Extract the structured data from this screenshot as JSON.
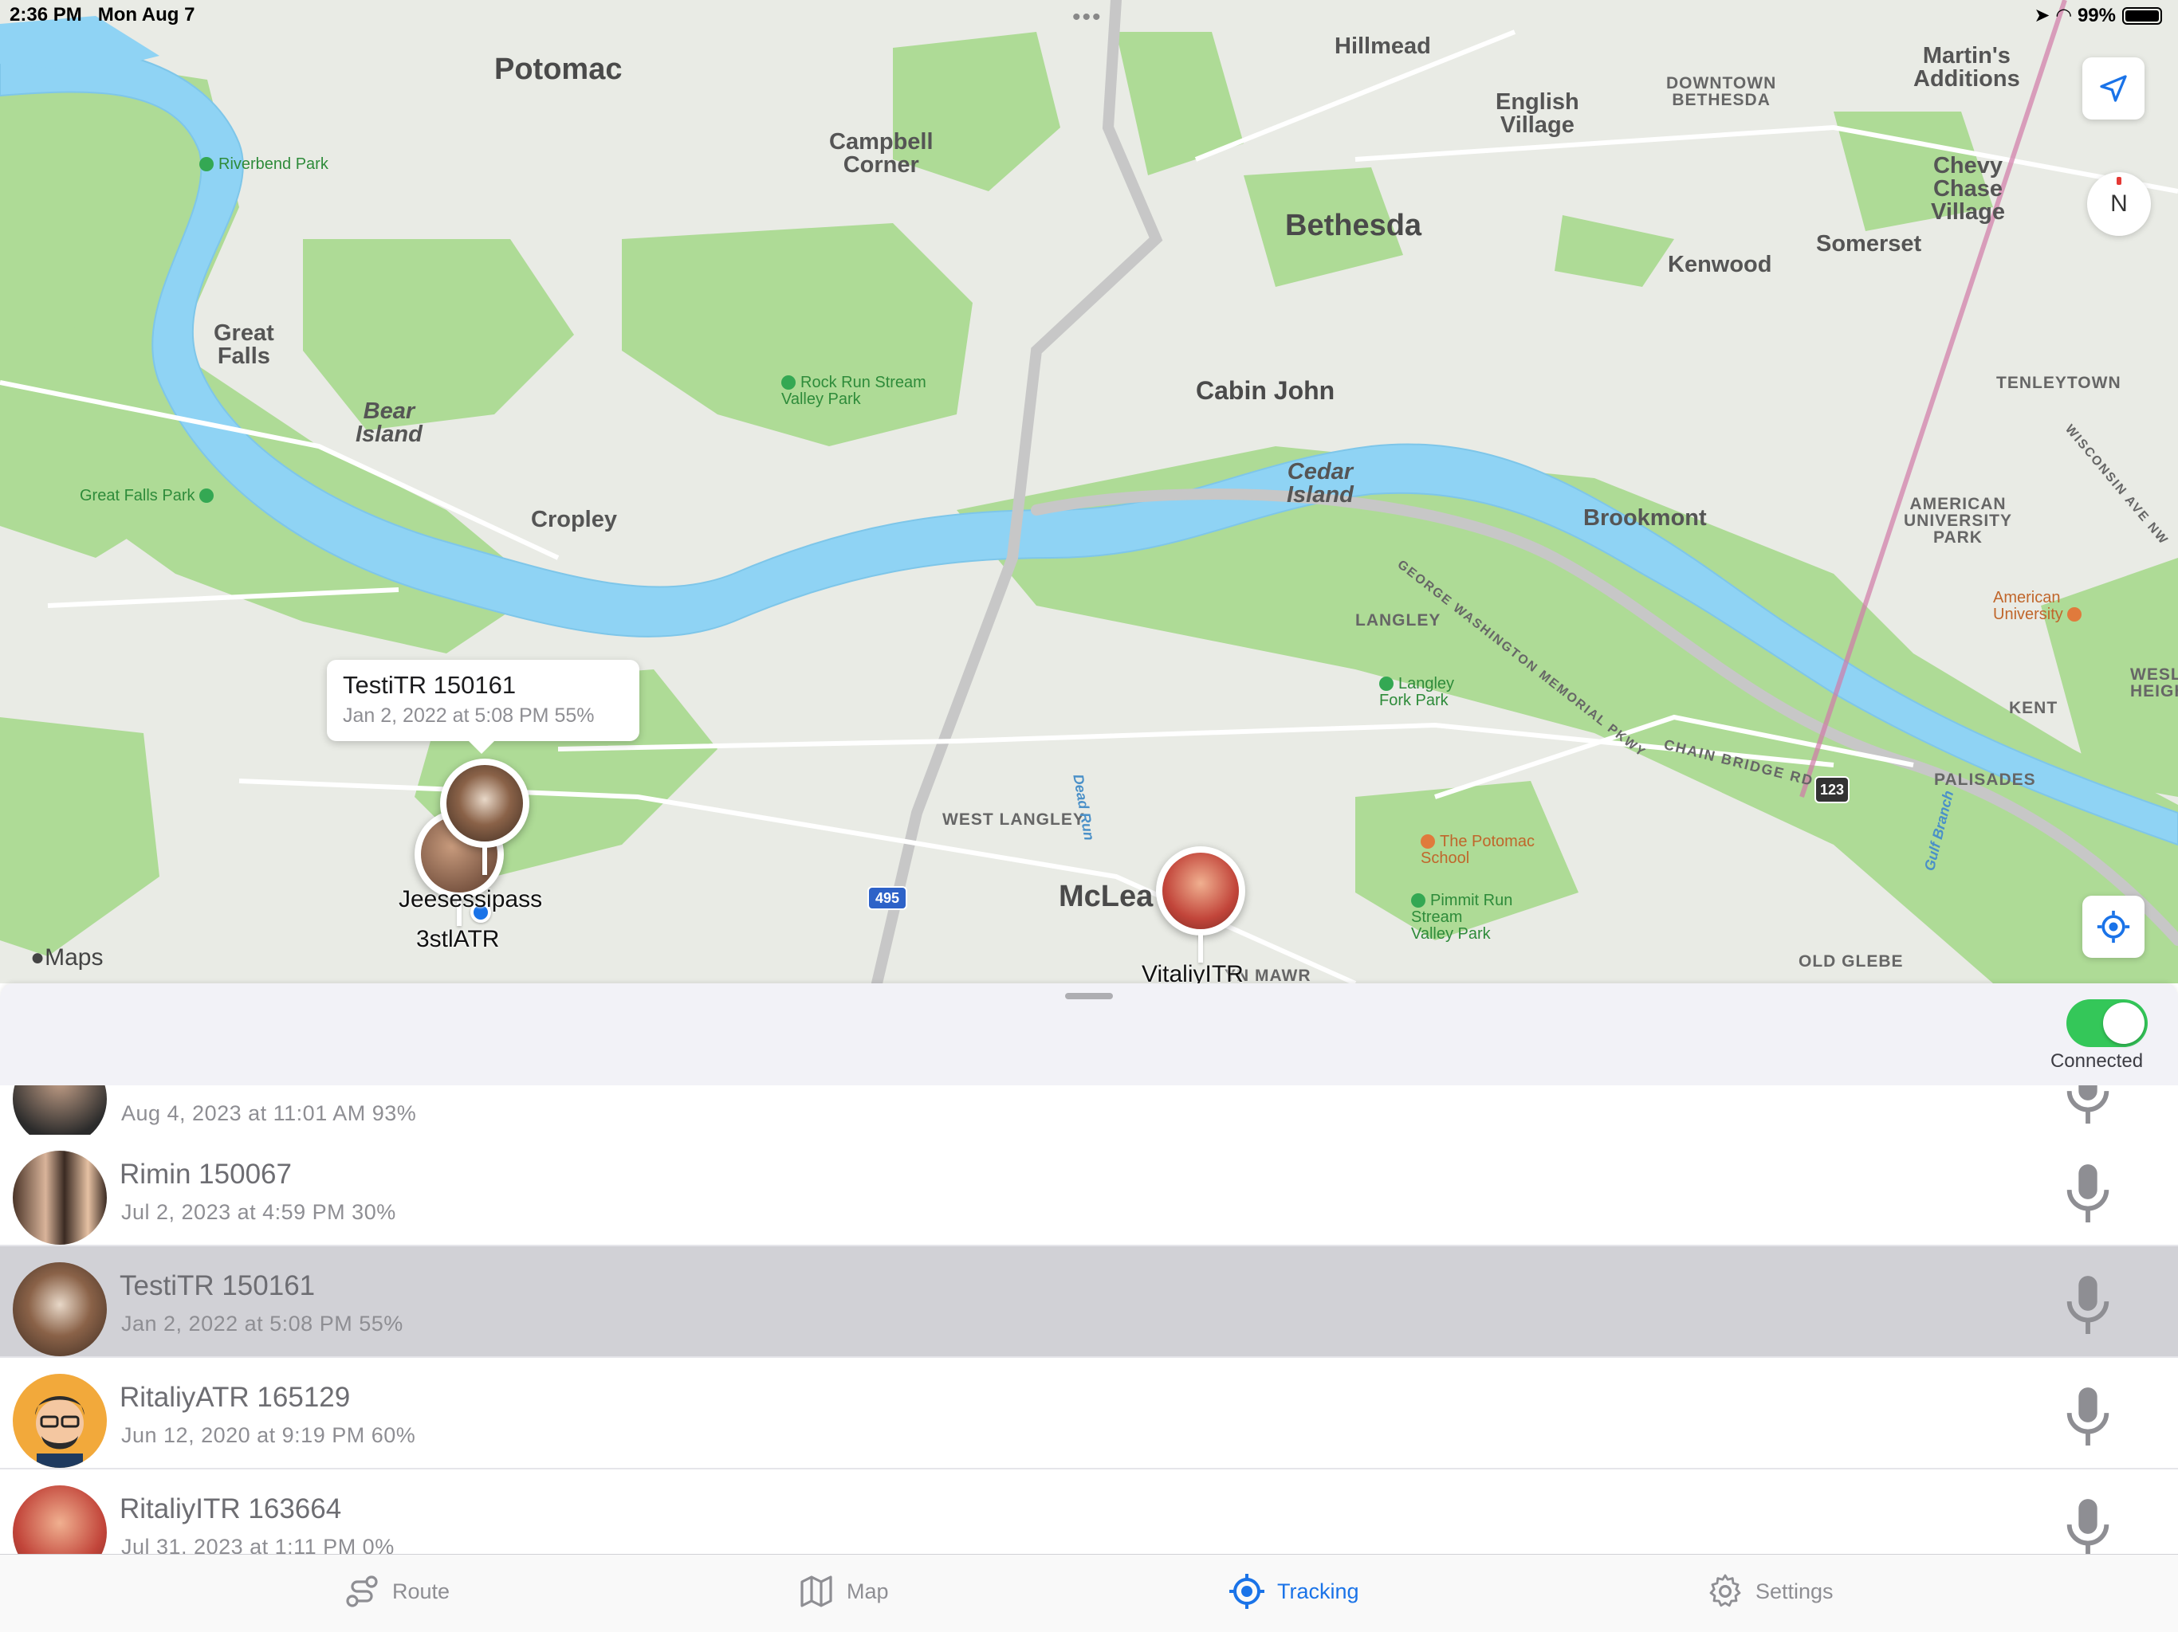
{
  "status_bar": {
    "time": "2:36 PM",
    "date": "Mon Aug 7",
    "battery": "99%",
    "battery_level": 0.99
  },
  "map": {
    "places": {
      "potomac": "Potomac",
      "hillmead": "Hillmead",
      "martins_additions": "Martin's\nAdditions",
      "english_village": "English\nVillage",
      "downtown_bethesda": "DOWNTOWN\nBETHESDA",
      "campbell_corner": "Campbell\nCorner",
      "bethesda": "Bethesda",
      "chevy_chase_village": "Chevy\nChase\nVillage",
      "kenwood": "Kenwood",
      "somerset": "Somerset",
      "great_falls": "Great\nFalls",
      "bear_island": "Bear\nIsland",
      "cabin_john": "Cabin John",
      "tenleytown": "TENLEYTOWN",
      "cropley": "Cropley",
      "cedar_island": "Cedar\nIsland",
      "brookmont": "Brookmont",
      "american_university_park": "AMERICAN\nUNIVERSITY\nPARK",
      "langley": "LANGLEY",
      "kent": "KENT",
      "wesley_heights": "WESLE\nHEIGH",
      "palisades": "PALISADES",
      "west_langley": "WEST LANGLEY",
      "mclean": "McLea",
      "old_glebe": "OLD GLEBE",
      "bryn_mawr": "YN MAWR"
    },
    "parks": {
      "riverbend": "Riverbend Park",
      "rock_run": "Rock Run Stream\nValley Park",
      "great_falls_park": "Great Falls Park",
      "langley_fork": "Langley\nFork Park",
      "pimmit_run": "Pimmit Run\nStream\nValley Park"
    },
    "pois": {
      "american_university": "American\nUniversity",
      "potomac_school": "The Potomac\nSchool"
    },
    "roads": {
      "gw_parkway": "GEORGE WASHINGTON MEMORIAL PKWY",
      "chain_bridge": "CHAIN BRIDGE RD",
      "wisconsin": "WISCONSIN AVE NW",
      "dead_run": "Dead Run",
      "gulf_branch": "Gulf Branch",
      "i495": "495",
      "r123": "123"
    },
    "attribution": "Maps",
    "compass": "N",
    "callout": {
      "title": "TestiTR 150161",
      "subtitle": "Jan 2, 2022 at 5:08 PM   55%"
    },
    "pin_labels": {
      "cluster_a": "Jeesessipass",
      "cluster_b": "3stlATR",
      "vitaliy": "VitaliyITR"
    },
    "icons": {
      "locate": "location-arrow-icon",
      "recenter": "target-icon"
    }
  },
  "sheet": {
    "toggle_label": "Connected",
    "toggle_on": true
  },
  "rows": [
    {
      "name": "",
      "sub": "Aug 4, 2023 at 11:01 AM   93%",
      "selected": false,
      "avatar": "avatar-partial"
    },
    {
      "name": "Rimin 150067",
      "sub": "Jul 2, 2023 at 4:59 PM   30%",
      "selected": false,
      "avatar": "avatar-couple"
    },
    {
      "name": "TestiTR 150161",
      "sub": "Jan 2, 2022 at 5:08 PM   55%",
      "selected": true,
      "avatar": "avatar-dog"
    },
    {
      "name": "RitaliyATR 165129",
      "sub": "Jun 12, 2020 at 9:19 PM   60%",
      "selected": false,
      "avatar": "avatar-cartoon"
    },
    {
      "name": "RitaliyITR 163664",
      "sub": "Jul 31, 2023 at 1:11 PM   0%",
      "selected": false,
      "avatar": "avatar-statue"
    }
  ],
  "tabs": [
    {
      "label": "Route",
      "icon": "route-icon",
      "active": false
    },
    {
      "label": "Map",
      "icon": "map-icon",
      "active": false
    },
    {
      "label": "Tracking",
      "icon": "tracking-icon",
      "active": true
    },
    {
      "label": "Settings",
      "icon": "gear-icon",
      "active": false
    }
  ],
  "colors": {
    "accent": "#1a73e8",
    "toggle_on": "#34c759",
    "selected_row": "#d1d1d6",
    "water": "#8fd3f4",
    "park": "#a8dc8c"
  }
}
